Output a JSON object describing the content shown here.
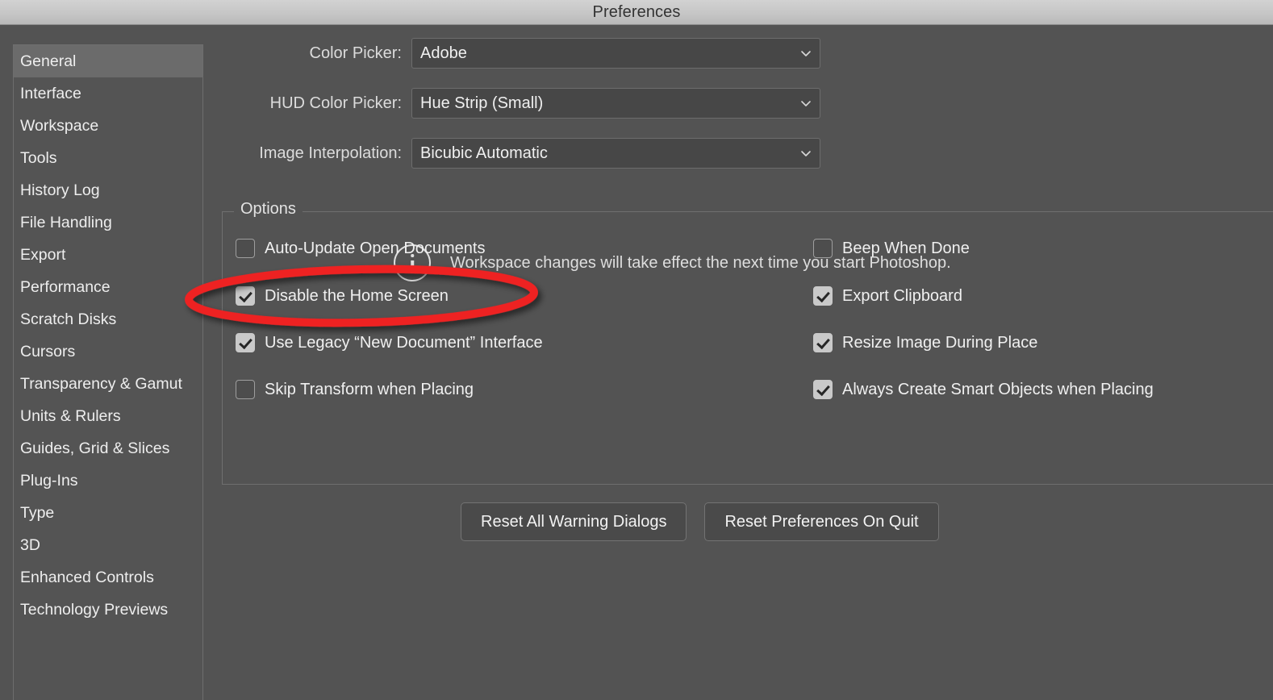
{
  "window": {
    "title": "Preferences"
  },
  "sidebar": {
    "items": [
      {
        "label": "General",
        "selected": true
      },
      {
        "label": "Interface",
        "selected": false
      },
      {
        "label": "Workspace",
        "selected": false
      },
      {
        "label": "Tools",
        "selected": false
      },
      {
        "label": "History Log",
        "selected": false
      },
      {
        "label": "File Handling",
        "selected": false
      },
      {
        "label": "Export",
        "selected": false
      },
      {
        "label": "Performance",
        "selected": false
      },
      {
        "label": "Scratch Disks",
        "selected": false
      },
      {
        "label": "Cursors",
        "selected": false
      },
      {
        "label": "Transparency & Gamut",
        "selected": false
      },
      {
        "label": "Units & Rulers",
        "selected": false
      },
      {
        "label": "Guides, Grid & Slices",
        "selected": false
      },
      {
        "label": "Plug-Ins",
        "selected": false
      },
      {
        "label": "Type",
        "selected": false
      },
      {
        "label": "3D",
        "selected": false
      },
      {
        "label": "Enhanced Controls",
        "selected": false
      },
      {
        "label": "Technology Previews",
        "selected": false
      }
    ]
  },
  "fields": [
    {
      "label": "Color Picker:",
      "value": "Adobe",
      "icon": "chevron-down-icon"
    },
    {
      "label": "HUD Color Picker:",
      "value": "Hue Strip (Small)",
      "icon": "chevron-down-icon"
    },
    {
      "label": "Image Interpolation:",
      "value": "Bicubic Automatic",
      "icon": "chevron-down-icon"
    }
  ],
  "options": {
    "legend": "Options",
    "left_column": [
      {
        "label": "Auto-Update Open Documents",
        "checked": false
      },
      {
        "label": "Disable the Home Screen",
        "checked": true
      },
      {
        "label": "Use Legacy “New Document” Interface",
        "checked": true
      },
      {
        "label": "Skip Transform when Placing",
        "checked": false
      }
    ],
    "right_column": [
      {
        "label": "Beep When Done",
        "checked": false
      },
      {
        "label": "Export Clipboard",
        "checked": true
      },
      {
        "label": "Resize Image During Place",
        "checked": true
      },
      {
        "label": "Always Create Smart Objects when Placing",
        "checked": true
      }
    ],
    "note": {
      "icon": "info-icon",
      "text": "Workspace changes will take effect the next time you start Photoshop."
    }
  },
  "buttons": [
    {
      "label": "Reset All Warning Dialogs"
    },
    {
      "label": "Reset Preferences On Quit"
    }
  ],
  "annotation": {
    "shape": "ellipse-highlight",
    "color": "#ee2222",
    "targets": "Disable the Home Screen"
  },
  "colors": {
    "dialog_background": "#535353",
    "titlebar_top": "#d2d2d2",
    "titlebar_bottom": "#b9b9b9",
    "selected_item": "#6b6b6b",
    "control_fill": "#474747",
    "annotation_red": "#ee2222"
  }
}
